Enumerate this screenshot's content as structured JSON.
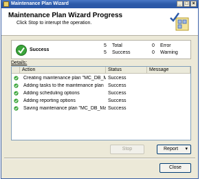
{
  "window": {
    "title": "Maintenance Plan Wizard"
  },
  "titlebar_buttons": {
    "minimize": "_",
    "maximize": "□",
    "close": "×"
  },
  "header": {
    "title": "Maintenance Plan Wizard Progress",
    "subtitle": "Click Stop to interupt the operation."
  },
  "summary": {
    "state": "Success",
    "total_count": "5",
    "total_label": "Total",
    "success_count": "5",
    "success_label": "Success",
    "error_count": "0",
    "error_label": "Error",
    "warning_count": "0",
    "warning_label": "Warning"
  },
  "details": {
    "label": "Details:",
    "columns": [
      "Action",
      "Status",
      "Message"
    ],
    "rows": [
      {
        "action": "Creating maintenance plan \"MC_DB_M...",
        "status": "Success",
        "message": ""
      },
      {
        "action": "Adding tasks to the maintenance plan",
        "status": "Success",
        "message": ""
      },
      {
        "action": "Adding scheduling options",
        "status": "Success",
        "message": ""
      },
      {
        "action": "Adding reporting options",
        "status": "Success",
        "message": ""
      },
      {
        "action": "Saving maintenance plan \"MC_DB_Mai...",
        "status": "Success",
        "message": ""
      }
    ]
  },
  "buttons": {
    "stop": "Stop",
    "report": "Report",
    "close": "Close"
  },
  "colors": {
    "success_green": "#3aa53a",
    "title_blue": "#2c5aa8"
  }
}
